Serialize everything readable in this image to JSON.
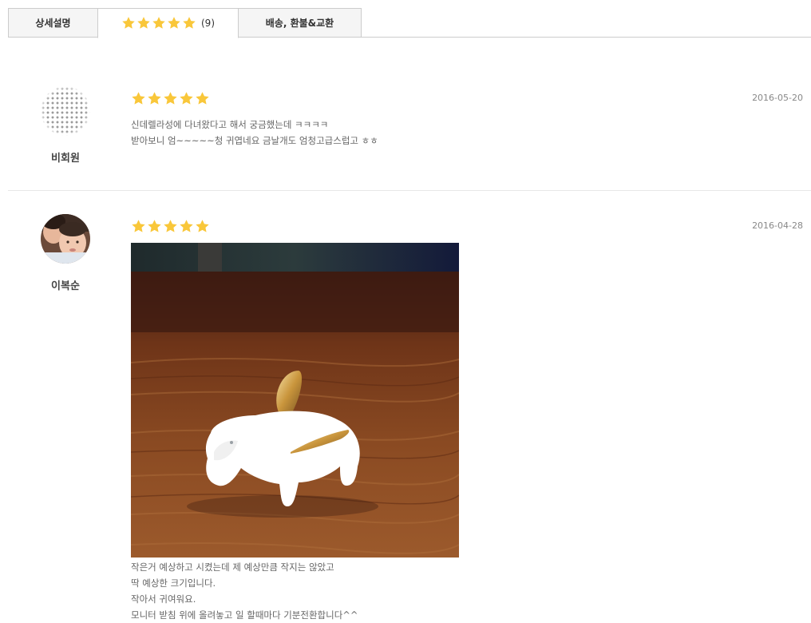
{
  "tabs": {
    "detail_label": "상세설명",
    "review_count": "(9)",
    "review_stars": 5,
    "shipping_label": "배송, 환불&교환"
  },
  "reviews": [
    {
      "user": "비회원",
      "avatar": "dotted-placeholder",
      "rating": 5,
      "date": "2016-05-20",
      "lines": [
        "신데렐라성에 다녀왔다고 해서 궁금했는데 ㅋㅋㅋㅋ",
        "받아보니 엄~~~~~청 귀엽네요 금날개도 엄청고급스럽고 ㅎㅎ"
      ]
    },
    {
      "user": "이복순",
      "avatar": "photo-mother-child",
      "rating": 5,
      "date": "2016-04-28",
      "photo": "white-porcelain-bunny-figurine-with-gold-ears",
      "lines": [
        "작은거 예상하고 시켰는데 제 예상만큼 작지는 않았고",
        "딱 예상한 크기입니다.",
        "작아서 귀여워요.",
        "모니터 받침 위에 올려놓고 일 할때마다 기분전환합니다^^"
      ]
    }
  ],
  "colors": {
    "star": "#f9c73a",
    "tab_border": "#cccccc",
    "divider": "#e8e8e8"
  }
}
